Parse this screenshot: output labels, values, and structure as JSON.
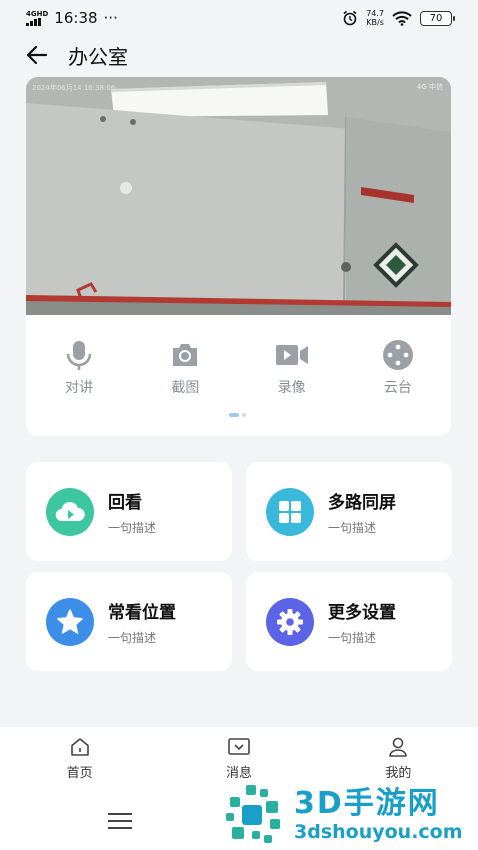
{
  "status_bar": {
    "network": "4GHD",
    "time": "16:38",
    "more": "···",
    "speed_value": "74.7",
    "speed_unit": "KB/s",
    "battery": "70"
  },
  "header": {
    "title": "办公室"
  },
  "video": {
    "timestamp": "2024年06月14  16:38:06",
    "network_label": "4G 中信"
  },
  "controls": [
    {
      "label": "对讲",
      "icon": "microphone-icon"
    },
    {
      "label": "截图",
      "icon": "camera-icon"
    },
    {
      "label": "录像",
      "icon": "video-camera-icon"
    },
    {
      "label": "云台",
      "icon": "ptz-control-icon"
    }
  ],
  "features": [
    {
      "title": "回看",
      "subtitle": "一句描述",
      "icon": "cloud-play-icon",
      "color": "#3ec6a0"
    },
    {
      "title": "多路同屏",
      "subtitle": "一句描述",
      "icon": "grid-icon",
      "color": "#39b8dc"
    },
    {
      "title": "常看位置",
      "subtitle": "一句描述",
      "icon": "star-icon",
      "color": "#3d8ee8"
    },
    {
      "title": "更多设置",
      "subtitle": "一句描述",
      "icon": "gear-icon",
      "color": "#5b63e6"
    }
  ],
  "bottom_nav": [
    {
      "label": "首页",
      "icon": "home-icon"
    },
    {
      "label": "消息",
      "icon": "inbox-icon"
    },
    {
      "label": "我的",
      "icon": "user-icon"
    }
  ],
  "watermark": {
    "title": "3D手游网",
    "url": "3dshouyou.com"
  },
  "colors": {
    "accent": "#3d8ee8",
    "background": "#f2f4f6",
    "control_gray": "#9aa0a6"
  }
}
